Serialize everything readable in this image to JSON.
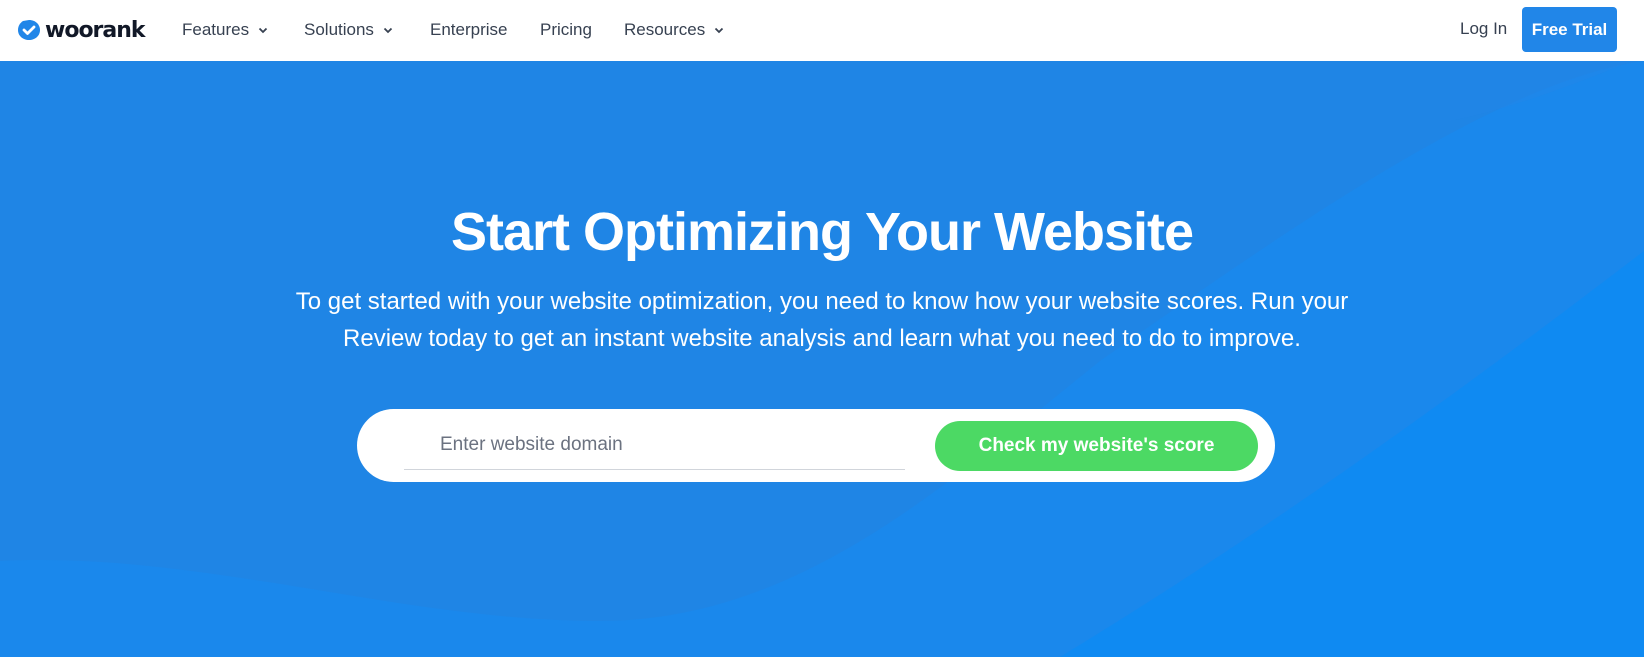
{
  "brand": {
    "name": "woorank",
    "logo_icon": "check-badge-icon",
    "accent_color": "#2186e8"
  },
  "nav": {
    "items": [
      {
        "label": "Features",
        "has_dropdown": true
      },
      {
        "label": "Solutions",
        "has_dropdown": true
      },
      {
        "label": "Enterprise",
        "has_dropdown": false
      },
      {
        "label": "Pricing",
        "has_dropdown": false
      },
      {
        "label": "Resources",
        "has_dropdown": true
      }
    ],
    "login_label": "Log In",
    "free_trial_label": "Free Trial"
  },
  "hero": {
    "background_color": "#1a8bee",
    "headline": "Start Optimizing Your Website",
    "subtext_line1": "To get started with your website optimization, you need to know how your website scores. Run your",
    "subtext_line2": "Review today to get an instant website analysis and learn what you need to do to improve.",
    "search": {
      "placeholder": "Enter website domain",
      "value": "",
      "button_label": "Check my website's score",
      "button_color": "#4cd964"
    }
  }
}
